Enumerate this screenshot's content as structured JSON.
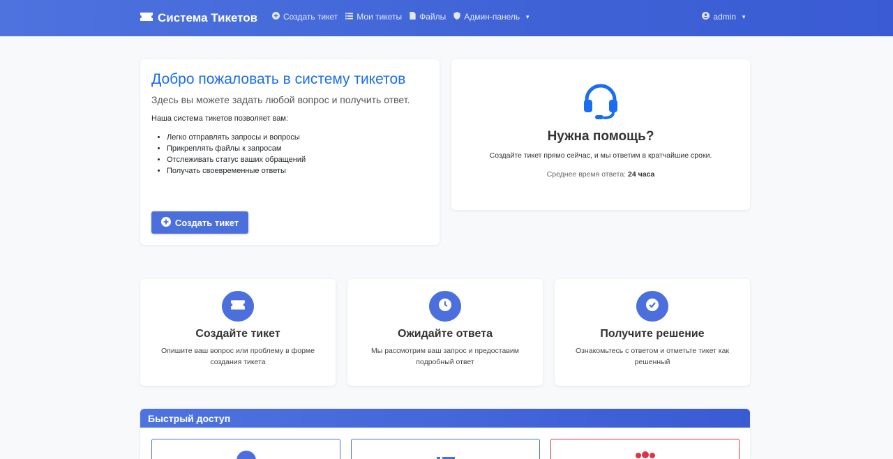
{
  "navbar": {
    "brand": "Система Тикетов",
    "brand_icon": "ticket-icon",
    "links": [
      {
        "label": "Создать тикет",
        "icon": "plus-circle-icon"
      },
      {
        "label": "Мои тикеты",
        "icon": "list-icon"
      },
      {
        "label": "Файлы",
        "icon": "file-icon"
      },
      {
        "label": "Админ-панель",
        "icon": "shield-icon"
      }
    ],
    "user": "admin"
  },
  "welcome": {
    "title": "Добро пожаловать в систему тикетов",
    "lead": "Здесь вы можете задать любой вопрос и получить ответ.",
    "intro": "Наша система тикетов позволяет вам:",
    "features": [
      "Легко отправлять запросы и вопросы",
      "Прикреплять файлы к запросам",
      "Отслеживать статус ваших обращений",
      "Получать своевременные ответы"
    ],
    "button": "Создать тикет"
  },
  "help": {
    "title": "Нужна помощь?",
    "subtitle": "Создайте тикет прямо сейчас, и мы ответим в кратчайшие сроки.",
    "avg_label": "Среднее время ответа:",
    "avg_value": "24 часа"
  },
  "steps": [
    {
      "title": "Создайте тикет",
      "text": "Опишите ваш вопрос или проблему в форме создания тикета",
      "icon": "ticket-icon"
    },
    {
      "title": "Ожидайте ответа",
      "text": "Мы рассмотрим ваш запрос и предоставим подробный ответ",
      "icon": "clock-icon"
    },
    {
      "title": "Получите решение",
      "text": "Ознакомьтесь с ответом и отметьте тикет как решенный",
      "icon": "check-circle-icon"
    }
  ],
  "quick_access": {
    "title": "Быстрый доступ"
  },
  "colors": {
    "primary": "#4b70de",
    "title_blue": "#1a6cf2",
    "danger": "#dc3545"
  }
}
